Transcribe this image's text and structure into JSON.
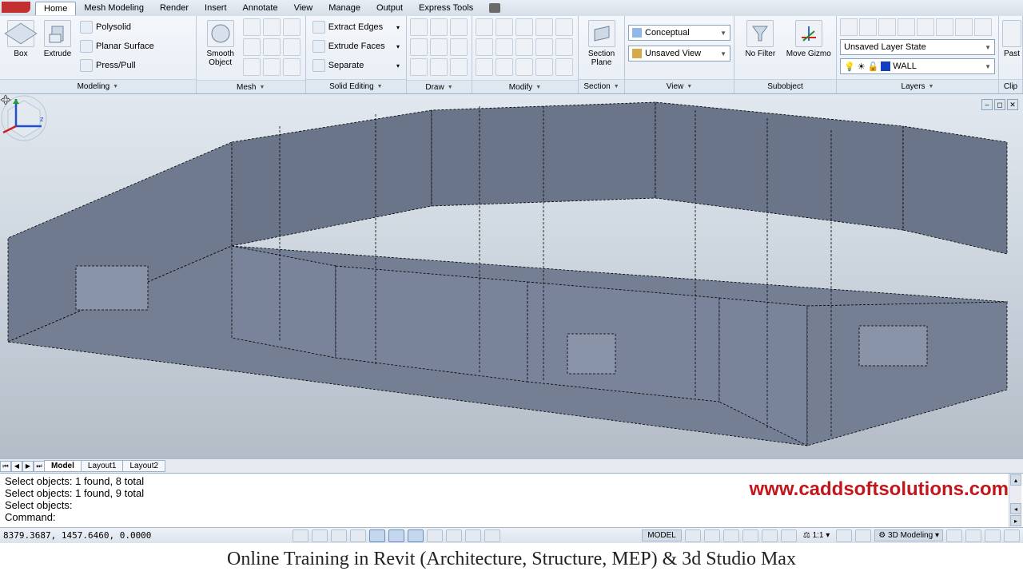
{
  "menubar": {
    "items": [
      "Home",
      "Mesh Modeling",
      "Render",
      "Insert",
      "Annotate",
      "View",
      "Manage",
      "Output",
      "Express Tools"
    ],
    "active": 0
  },
  "ribbon": {
    "modeling": {
      "title": "Modeling",
      "box": "Box",
      "extrude": "Extrude",
      "polysolid": "Polysolid",
      "planar": "Planar Surface",
      "presspull": "Press/Pull"
    },
    "mesh": {
      "title": "Mesh",
      "smooth": "Smooth\nObject"
    },
    "solidediting": {
      "title": "Solid Editing",
      "extractedges": "Extract Edges",
      "extrudefaces": "Extrude Faces",
      "separate": "Separate"
    },
    "draw": {
      "title": "Draw"
    },
    "modify": {
      "title": "Modify"
    },
    "section": {
      "title": "Section",
      "plane": "Section\nPlane"
    },
    "view": {
      "title": "View",
      "visualstyle": "Conceptual",
      "savedview": "Unsaved View"
    },
    "subobject": {
      "title": "Subobject",
      "nofilter": "No Filter",
      "movegizmo": "Move Gizmo"
    },
    "layers": {
      "title": "Layers",
      "state": "Unsaved Layer State",
      "current": "WALL"
    },
    "clipboard": {
      "title": "Clip",
      "paste": "Past"
    }
  },
  "viewport": {
    "controls": {
      "min": "–",
      "max": "◻",
      "close": "✕"
    }
  },
  "layouttabs": {
    "tabs": [
      "Model",
      "Layout1",
      "Layout2"
    ],
    "active": 0
  },
  "command": {
    "lines": [
      "Select objects: 1 found, 8 total",
      "Select objects: 1 found, 9 total",
      "Select objects:",
      "Command:"
    ],
    "watermark": "www.caddsoftsolutions.com"
  },
  "statusbar": {
    "coords": "8379.3687, 1457.6460, 0.0000",
    "model": "MODEL",
    "scale": "1:1",
    "workspace": "3D Modeling"
  },
  "banner": "Online Training in Revit (Architecture, Structure, MEP) & 3d Studio Max"
}
